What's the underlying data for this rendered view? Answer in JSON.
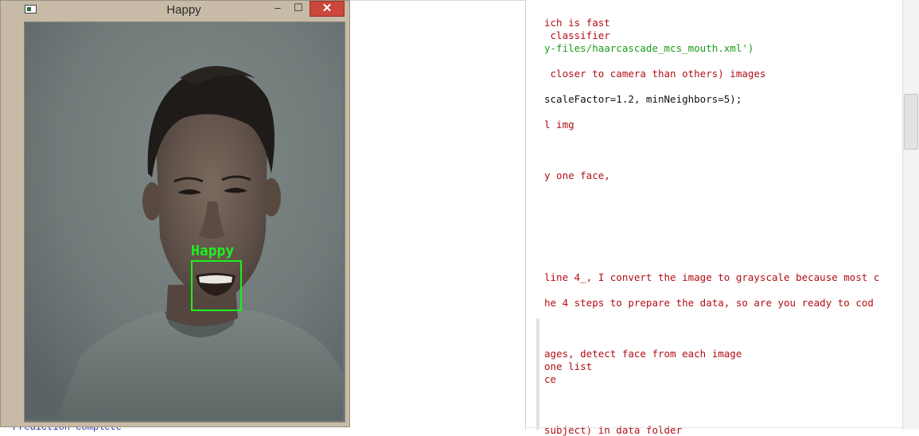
{
  "window": {
    "title": "Happy",
    "controls": {
      "minimize": "–",
      "maximize": "☐",
      "close": "✕"
    },
    "detection": {
      "label": "Happy",
      "box_color": "#1cf01c"
    }
  },
  "console": {
    "prefix": "P",
    "last_line": "Prediction complete",
    "line_count": 33
  },
  "editor": {
    "lines": [
      {
        "text": "ich is fast",
        "kind": "comment"
      },
      {
        "text": " classifier",
        "kind": "comment"
      },
      {
        "text": "y-files/haarcascade_mcs_mouth.xml')",
        "kind": "string"
      },
      {
        "text": "",
        "kind": "blank"
      },
      {
        "text": " closer to camera than others) images",
        "kind": "comment"
      },
      {
        "text": "",
        "kind": "blank"
      },
      {
        "text": "scaleFactor=1.2, minNeighbors=5);",
        "kind": "plain"
      },
      {
        "text": "",
        "kind": "blank"
      },
      {
        "text": "l img",
        "kind": "comment"
      },
      {
        "text": "",
        "kind": "blank"
      },
      {
        "text": "",
        "kind": "blank"
      },
      {
        "text": "",
        "kind": "blank"
      },
      {
        "text": "y one face,",
        "kind": "comment"
      },
      {
        "text": "",
        "kind": "blank"
      },
      {
        "text": "",
        "kind": "blank"
      },
      {
        "text": "",
        "kind": "blank"
      },
      {
        "text": "",
        "kind": "blank"
      },
      {
        "text": "",
        "kind": "blank"
      },
      {
        "text": "",
        "kind": "blank"
      },
      {
        "text": "",
        "kind": "blank"
      },
      {
        "text": "line 4_, I convert the image to grayscale because most c",
        "kind": "comment"
      },
      {
        "text": "",
        "kind": "blank"
      },
      {
        "text": "he 4 steps to prepare the data, so are you ready to cod",
        "kind": "comment"
      },
      {
        "text": "",
        "kind": "blank"
      },
      {
        "text": "",
        "kind": "blank"
      },
      {
        "text": "",
        "kind": "blank"
      },
      {
        "text": "ages, detect face from each image",
        "kind": "comment"
      },
      {
        "text": "one list",
        "kind": "comment"
      },
      {
        "text": "ce",
        "kind": "comment"
      },
      {
        "text": "",
        "kind": "blank"
      },
      {
        "text": "",
        "kind": "blank"
      },
      {
        "text": "",
        "kind": "blank"
      },
      {
        "text": "subject) in data folder",
        "kind": "comment"
      }
    ]
  },
  "colors": {
    "comment": "#b10f14",
    "string": "#1a9a16",
    "console_text": "#1d2a9a",
    "close_button": "#c9473b",
    "detection": "#1cf01c"
  }
}
